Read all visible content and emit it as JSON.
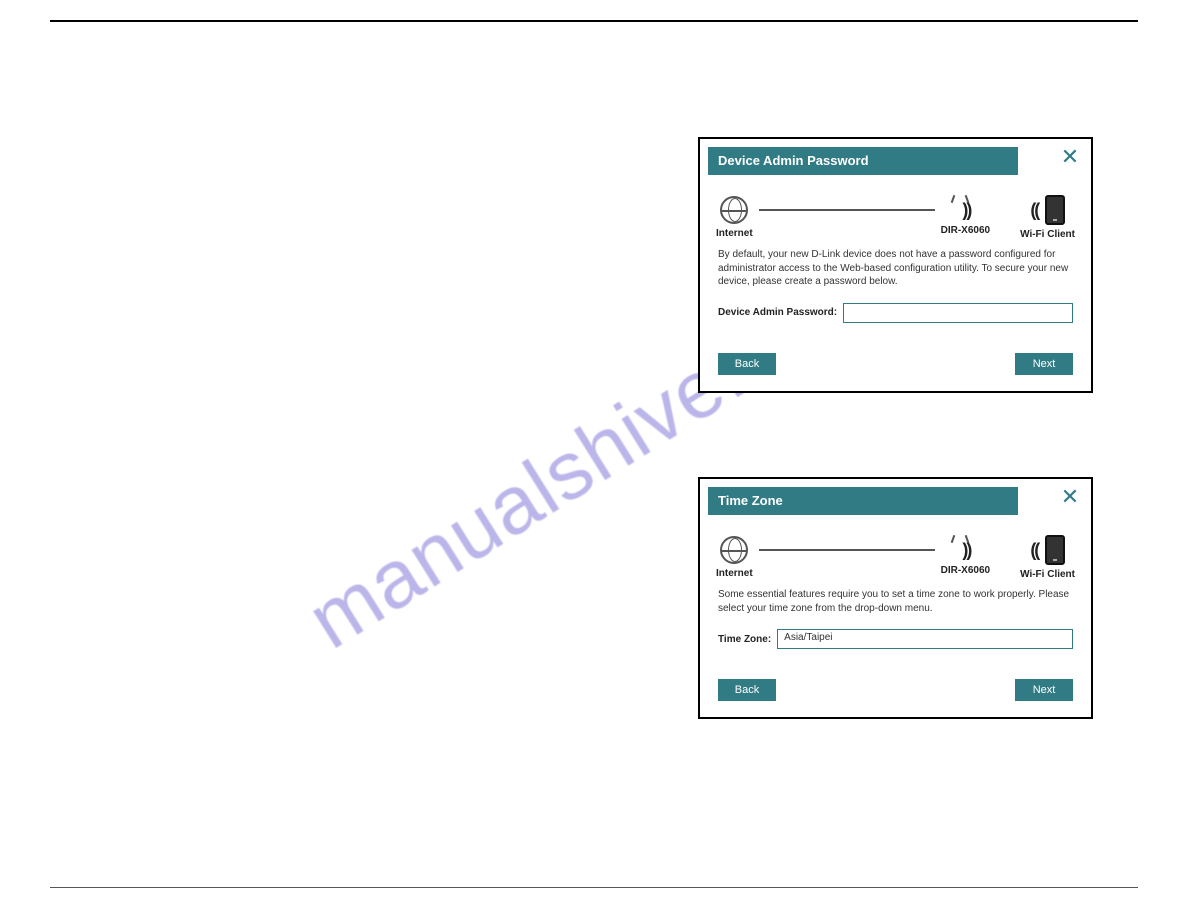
{
  "watermark": "manualshive.com",
  "diagram": {
    "internet": "Internet",
    "router": "DIR-X6060",
    "client": "Wi-Fi Client"
  },
  "dialog1": {
    "title": "Device Admin Password",
    "desc": "By default, your new D-Link device does not have a password configured for administrator access to the Web-based configuration utility. To secure your new device, please create a password below.",
    "field_label": "Device Admin Password:",
    "field_value": "",
    "back": "Back",
    "next": "Next"
  },
  "dialog2": {
    "title": "Time Zone",
    "desc": "Some essential features require you to set a time zone to work properly. Please select your time zone from the drop-down menu.",
    "field_label": "Time Zone:",
    "field_value": "Asia/Taipei",
    "back": "Back",
    "next": "Next"
  }
}
